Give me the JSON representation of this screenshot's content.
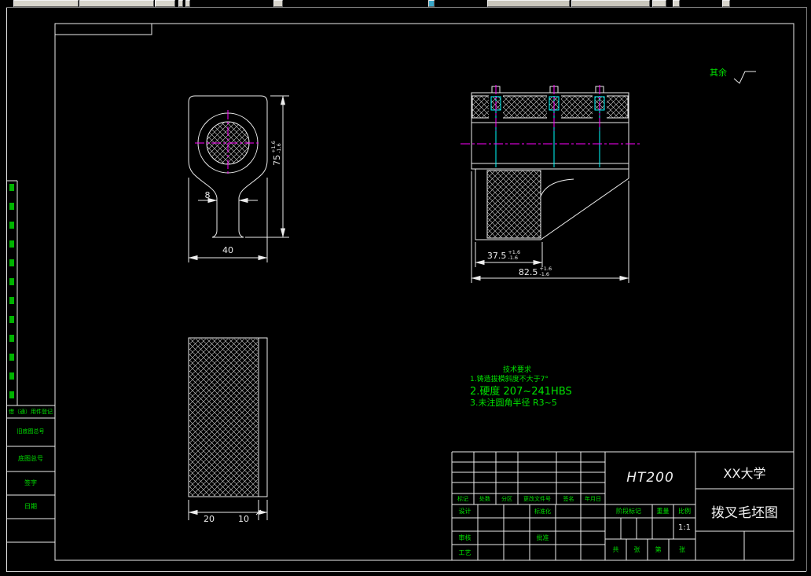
{
  "drawing": {
    "surface_note": "其余",
    "front_view": {
      "width": "40",
      "neck": "8",
      "height": "75",
      "height_tol_plus": "+1.6",
      "height_tol_minus": "-1.6"
    },
    "section_view": {
      "inner": "37.5",
      "inner_tol_plus": "+1.6",
      "inner_tol_minus": "-1.6",
      "overall": "82.5",
      "overall_tol_plus": "+1.6",
      "overall_tol_minus": "-1.6"
    },
    "side_view": {
      "left": "20",
      "right": "10"
    },
    "notes": {
      "title": "技术要求",
      "line1": "1.铸造拔模斜度不大于7°",
      "line2": "2.硬度 207~241HBS",
      "line3": "3.未注圆角半径 R3~5"
    }
  },
  "title_block": {
    "material": "HT200",
    "organization": "XX大学",
    "drawing_title": "拨叉毛坯图",
    "scale_value": "1:1",
    "h_mark": "标记",
    "h_count": "处数",
    "h_zone": "分区",
    "h_doc": "更改文件号",
    "h_sign": "签名",
    "h_date": "年月日",
    "r_design": "设计",
    "r_standard": "标准化",
    "r_check": "审核",
    "r_approve": "批准",
    "r_process": "工艺",
    "stage": "阶段标记",
    "weight": "重量",
    "scale": "比例",
    "s_total": "共",
    "s_sheet1": "张",
    "s_no": "第",
    "s_sheet2": "张"
  },
  "left_margin": {
    "row1": "借（通）用件登记",
    "row2": "旧底图总号",
    "row3": "底图总号",
    "row4": "签字",
    "row5": "日期"
  }
}
